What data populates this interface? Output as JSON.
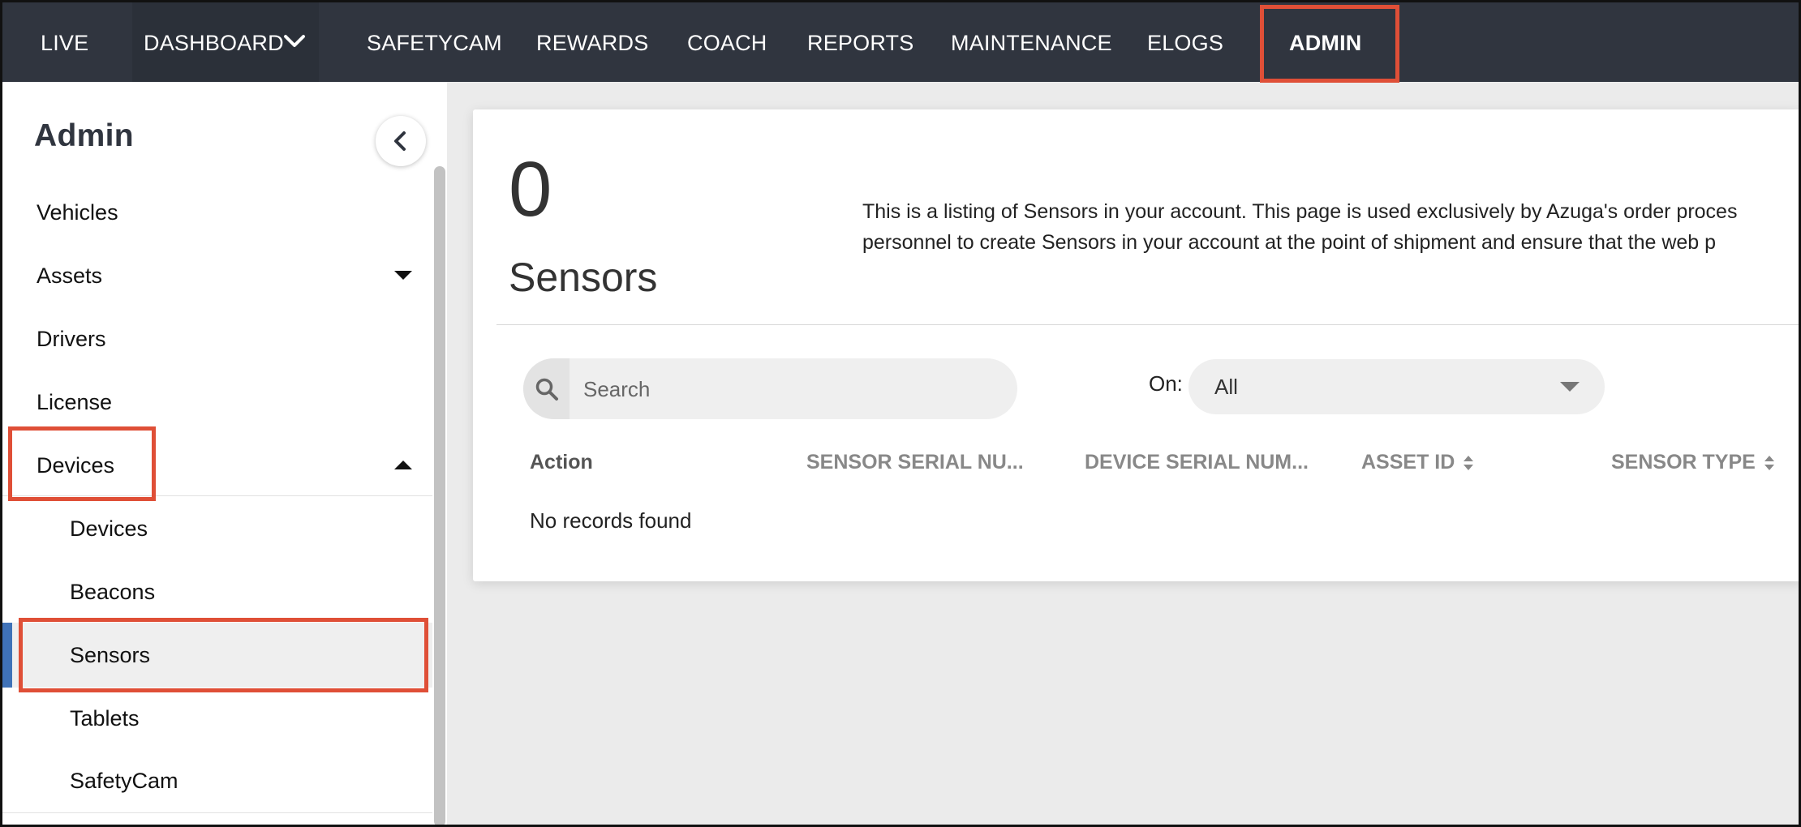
{
  "nav": {
    "items": [
      {
        "label": "LIVE"
      },
      {
        "label": "DASHBOARD"
      },
      {
        "label": "SAFETYCAM"
      },
      {
        "label": "REWARDS"
      },
      {
        "label": "COACH"
      },
      {
        "label": "REPORTS"
      },
      {
        "label": "MAINTENANCE"
      },
      {
        "label": "ELOGS"
      },
      {
        "label": "ADMIN",
        "active": true
      }
    ]
  },
  "sidebar": {
    "title": "Admin",
    "items": [
      {
        "label": "Vehicles"
      },
      {
        "label": "Assets"
      },
      {
        "label": "Drivers"
      },
      {
        "label": "License"
      },
      {
        "label": "Devices",
        "expanded": true
      }
    ],
    "subitems": [
      {
        "label": "Devices"
      },
      {
        "label": "Beacons"
      },
      {
        "label": "Sensors",
        "active": true
      },
      {
        "label": "Tablets"
      },
      {
        "label": "SafetyCam"
      }
    ]
  },
  "main": {
    "count": "0",
    "heading": "Sensors",
    "description_line1": "This is a listing of Sensors in your account. This page is used exclusively by Azuga's order proces",
    "description_line2": "personnel to create Sensors in your account at the point of shipment and ensure that the web p",
    "search_placeholder": "Search",
    "filter_label": "On:",
    "filter_value": "All",
    "table": {
      "columns": [
        "Action",
        "SENSOR SERIAL NU...",
        "DEVICE SERIAL NUM...",
        "ASSET ID",
        "SENSOR TYPE"
      ],
      "empty_text": "No records found"
    }
  },
  "colors": {
    "nav_bg": "#30353f",
    "highlight": "#df4f37",
    "active_accent": "#3f72b8"
  }
}
